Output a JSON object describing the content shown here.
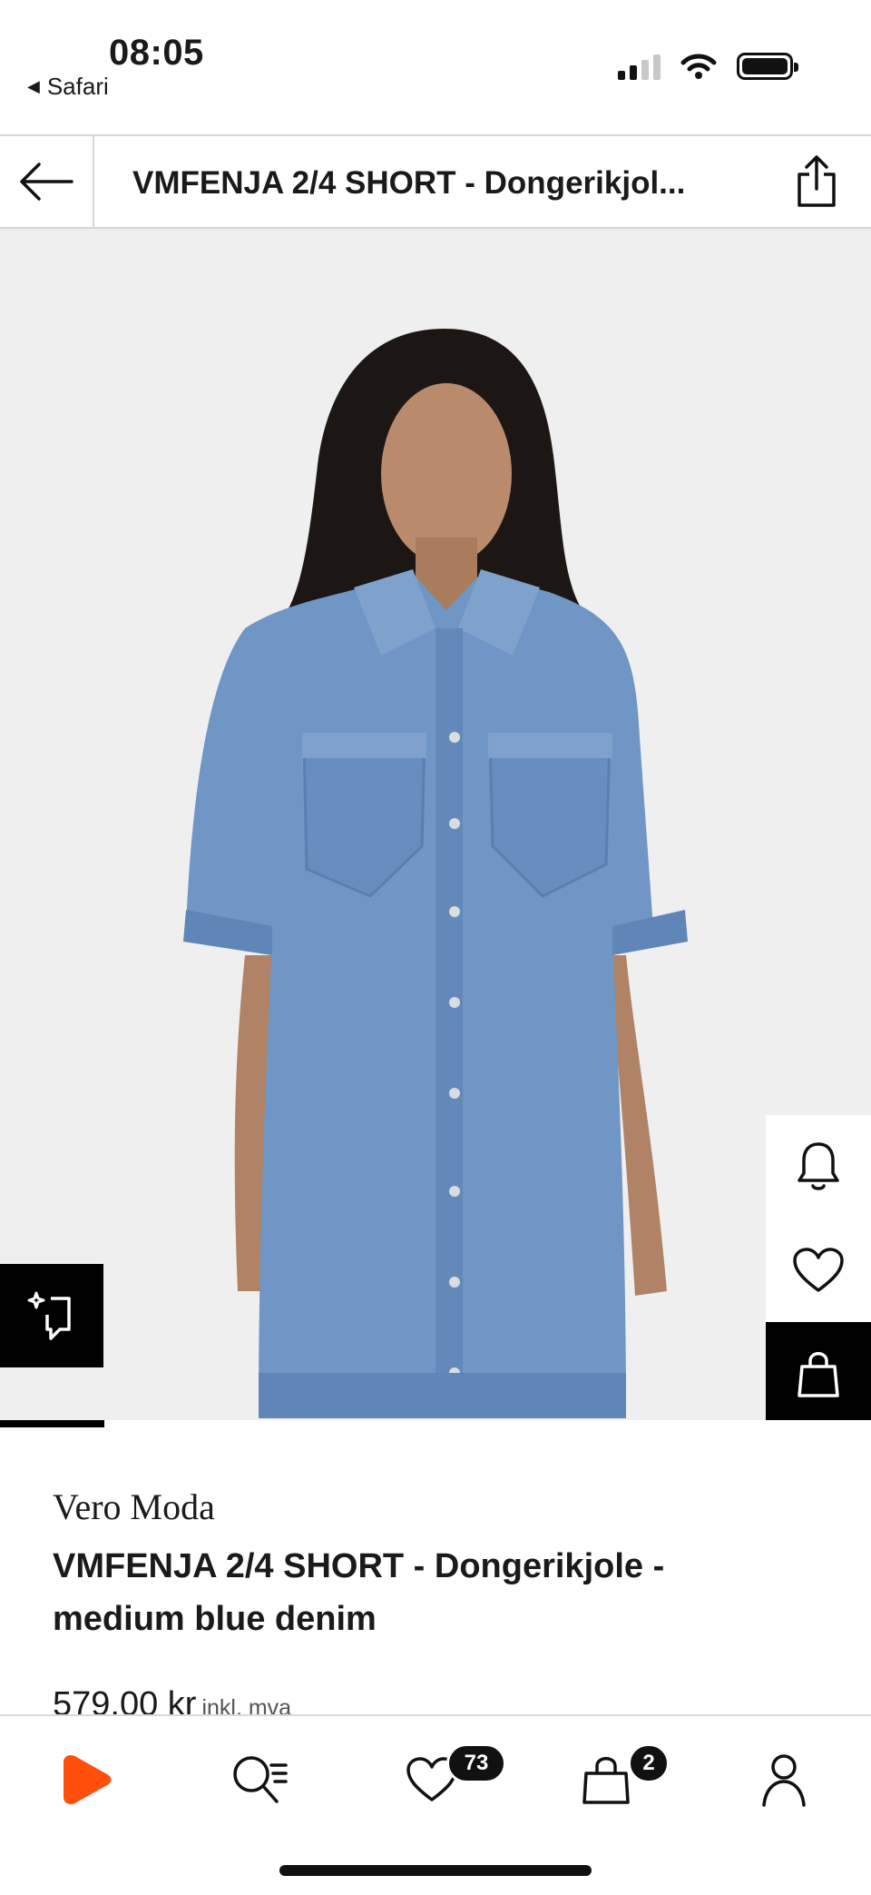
{
  "status_bar": {
    "time": "08:05",
    "back_app": "Safari"
  },
  "nav": {
    "title": "VMFENJA 2/4 SHORT - Dongerikjol..."
  },
  "image": {
    "progress_fraction": 0.12
  },
  "product": {
    "brand": "Vero Moda",
    "name": "VMFENJA 2/4 SHORT - Dongerikjole - medium blue denim",
    "price": "579,00 kr",
    "vat_note": "inkl. mva"
  },
  "tabbar": {
    "wishlist_count": "73",
    "cart_count": "2"
  },
  "colors": {
    "brand_accent": "#ff4f0b",
    "denim": "#6f96c4",
    "background": "#efefef"
  },
  "icons": [
    "back-arrow-icon",
    "share-icon",
    "bell-icon",
    "heart-icon",
    "bag-icon",
    "similar-items-icon",
    "zalando-logo-icon",
    "search-icon",
    "profile-icon"
  ]
}
